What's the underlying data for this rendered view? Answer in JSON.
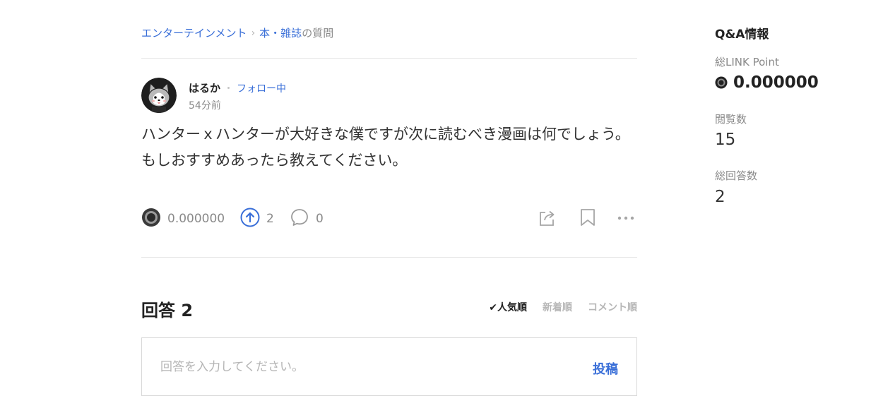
{
  "breadcrumb": {
    "category": "エンターテインメント",
    "separator": "›",
    "subcategory": "本・雑誌",
    "suffix": "の質問"
  },
  "author": {
    "name": "はるか",
    "follow_label": "フォロー中",
    "time": "54分前"
  },
  "question": {
    "text": "ハンターｘハンターが大好きな僕ですが次に読むべき漫画は何でしょう。もしおすすめあったら教えてください。"
  },
  "actions": {
    "point_value": "0.000000",
    "upvote_count": "2",
    "comment_count": "0"
  },
  "answers": {
    "title": "回答 2",
    "sort_options": [
      "人気順",
      "新着順",
      "コメント順"
    ],
    "active_sort": "人気順",
    "input_placeholder": "回答を入力してください。",
    "post_label": "投稿"
  },
  "sidebar": {
    "title": "Q&A情報",
    "link_point_label": "総LINK Point",
    "link_point_value": "0.000000",
    "views_label": "閲覧数",
    "views_value": "15",
    "answers_label": "総回答数",
    "answers_value": "2"
  },
  "colors": {
    "accent": "#3a6fd8",
    "text": "#222222",
    "muted": "#8a8a8a",
    "divider": "#e6e6e6"
  },
  "icons": [
    "link-point-icon",
    "upvote-icon",
    "comment-icon",
    "share-icon",
    "bookmark-icon",
    "more-icon"
  ]
}
